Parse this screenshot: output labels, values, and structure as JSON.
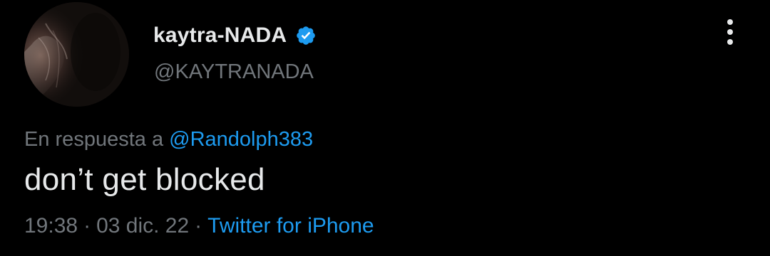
{
  "author": {
    "display_name": "kaytra-NADA",
    "handle": "@KAYTRANADA",
    "verified": true,
    "avatar_icon": "profile-photo"
  },
  "reply": {
    "prefix": "En respuesta a ",
    "to_handle": "@Randolph383"
  },
  "tweet": {
    "text": "don’t get blocked"
  },
  "meta": {
    "time": "19:38",
    "separator": "·",
    "date": "03 dic. 22",
    "source": "Twitter for iPhone"
  },
  "menu_icon": "more-vertical-icon",
  "colors": {
    "background": "#000000",
    "primary_text": "#e7e9ea",
    "secondary_text": "#71767b",
    "accent": "#1d9bf0"
  }
}
